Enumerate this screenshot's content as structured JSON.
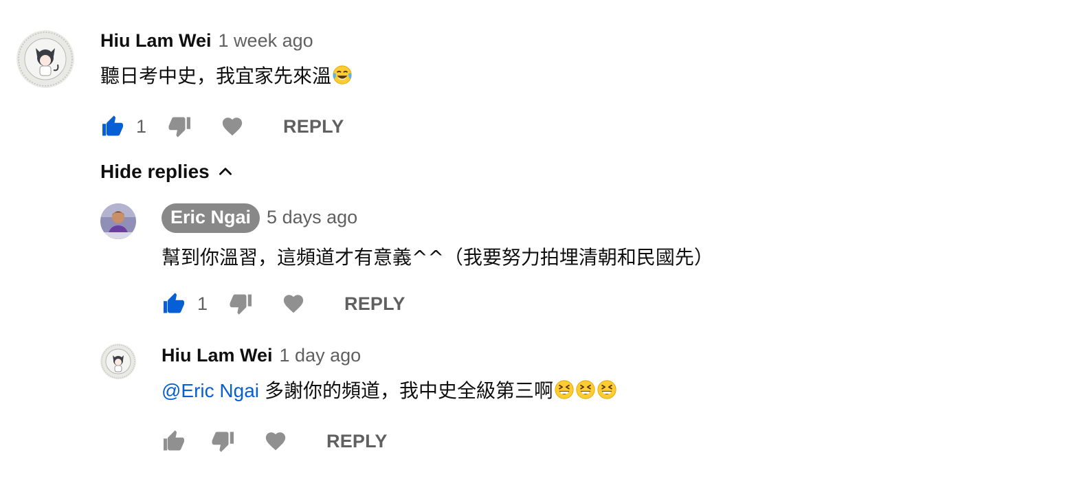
{
  "comment": {
    "author": "Hiu Lam Wei",
    "timestamp": "1 week ago",
    "text": "聽日考中史，我宜家先來溫",
    "emojis": [
      "face-with-tears-of-joy"
    ],
    "like_count": "1",
    "liked": true,
    "reply_label": "REPLY"
  },
  "toggle": {
    "label": "Hide replies"
  },
  "replies": [
    {
      "author": "Eric Ngai",
      "is_channel_owner": true,
      "timestamp": "5 days ago",
      "text": "幫到你溫習，這頻道才有意義^^（我要努力拍埋清朝和民國先）",
      "like_count": "1",
      "liked": true,
      "reply_label": "REPLY"
    },
    {
      "author": "Hiu Lam Wei",
      "is_channel_owner": false,
      "timestamp": "1 day ago",
      "mention": "@Eric Ngai",
      "text": "多謝你的頻道，我中史全級第三啊",
      "emojis": [
        "grinning-squinting-face",
        "grinning-squinting-face",
        "grinning-squinting-face"
      ],
      "like_count": "",
      "liked": false,
      "reply_label": "REPLY"
    }
  ],
  "colors": {
    "liked_blue": "#065fd4",
    "icon_gray": "#909090",
    "meta_gray": "#606060",
    "owner_badge": "#888888"
  }
}
